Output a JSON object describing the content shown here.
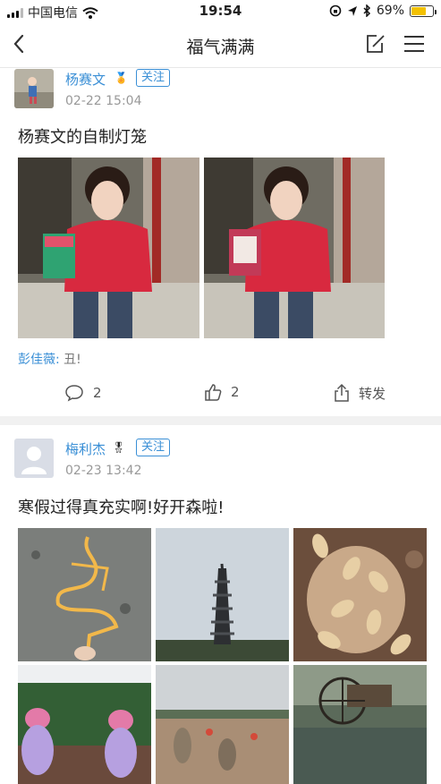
{
  "status_bar": {
    "carrier": "中国电信",
    "time": "19:54",
    "battery": "69%",
    "battery_level": 0.69,
    "battery_color": "#f3c100"
  },
  "nav": {
    "back_icon": "chevron-left-icon",
    "title": "福气满满",
    "edit_icon": "edit-icon",
    "menu_icon": "menu-icon"
  },
  "posts": [
    {
      "author": "杨赛文",
      "badge_icon": "medal-icon",
      "follow_label": "关注",
      "time": "02-22 15:04",
      "text": "杨赛文的自制灯笼",
      "photos": [
        "girl-with-lantern-photo-1",
        "girl-with-lantern-photo-2"
      ],
      "comment": {
        "name": "彭佳薇:",
        "text": "丑!"
      },
      "actions": {
        "comment_count": "2",
        "like_count": "2",
        "share_label": "转发"
      }
    },
    {
      "author": "梅利杰",
      "badge_icon": "medal-icon",
      "follow_label": "关注",
      "time": "02-23 13:42",
      "text": "寒假过得真充实啊!好开森啦!",
      "photos": [
        "sugar-painting-photo",
        "pagoda-photo",
        "peanuts-photo",
        "pig-statues-photo",
        "sculpture-park-photo",
        "waterwheel-photo"
      ]
    }
  ],
  "colors": {
    "accent": "#3a8fd6",
    "divider": "#f1f1f1"
  }
}
